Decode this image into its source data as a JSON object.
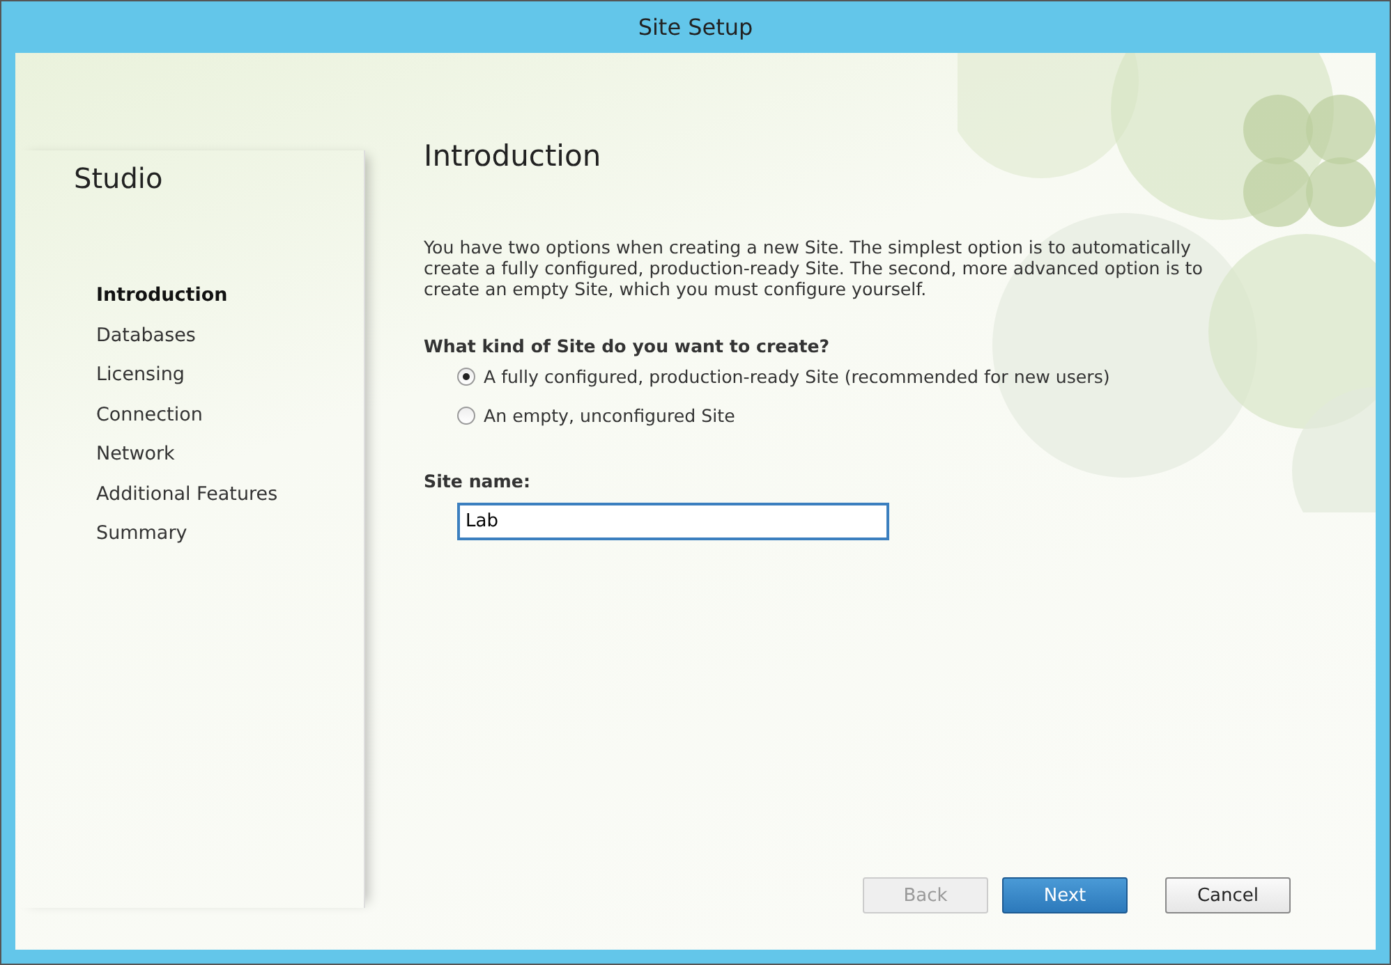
{
  "window": {
    "title": "Site Setup"
  },
  "sidebar": {
    "title": "Studio",
    "items": [
      {
        "label": "Introduction",
        "selected": true
      },
      {
        "label": "Databases",
        "selected": false
      },
      {
        "label": "Licensing",
        "selected": false
      },
      {
        "label": "Connection",
        "selected": false
      },
      {
        "label": "Network",
        "selected": false
      },
      {
        "label": "Additional Features",
        "selected": false
      },
      {
        "label": "Summary",
        "selected": false
      }
    ]
  },
  "page": {
    "heading": "Introduction",
    "description": "You have two options when creating a new Site. The simplest option is to automatically create a fully configured, production-ready Site. The second, more advanced option is to create an empty Site, which you must configure yourself.",
    "question": "What kind of Site do you want to create?",
    "options": [
      {
        "label": "A fully configured, production-ready Site (recommended for new users)",
        "selected": true
      },
      {
        "label": "An empty, unconfigured Site",
        "selected": false
      }
    ],
    "site_name": {
      "label": "Site name:",
      "value": "Lab"
    }
  },
  "buttons": [
    {
      "label": "Back",
      "kind": "secondary",
      "disabled": true
    },
    {
      "label": "Next",
      "kind": "primary",
      "disabled": false
    },
    {
      "label": "Cancel",
      "kind": "secondary",
      "disabled": false
    }
  ]
}
